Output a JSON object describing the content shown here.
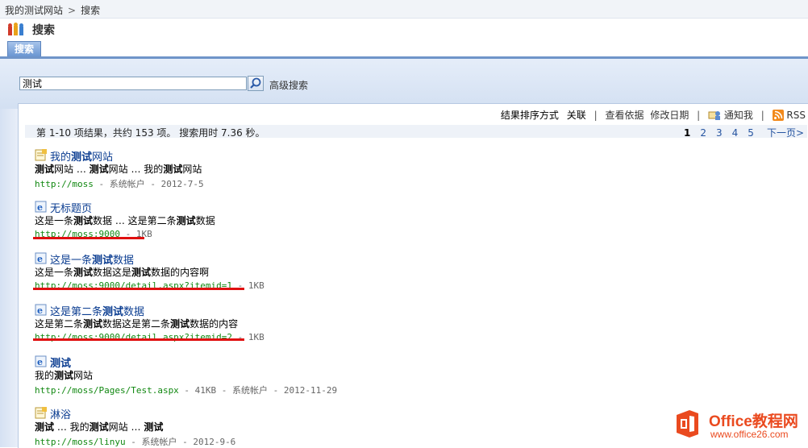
{
  "breadcrumb": {
    "site": "我的测试网站",
    "separator": ">",
    "current": "搜索"
  },
  "page": {
    "title": "搜索",
    "tab_label": "搜索"
  },
  "search": {
    "query": "测试",
    "advanced_label": "高级搜索"
  },
  "toolbar": {
    "sort_label": "结果排序方式",
    "sort_relevance": "关联",
    "view_by": "查看依据",
    "modified_date": "修改日期",
    "alert_me": "通知我",
    "rss": "RSS"
  },
  "summary": {
    "text": "第 1-10 项结果，共约 153 项。 搜索用时 7.36 秒。",
    "pages": [
      "1",
      "2",
      "3",
      "4",
      "5"
    ],
    "next": "下一页>"
  },
  "results": [
    {
      "icon": "note-doc-icon",
      "title_pre": "我的",
      "title_bold": "测试",
      "title_post": "网站",
      "snippet": [
        [
          "测试",
          true
        ],
        [
          "网站 … ",
          false
        ],
        [
          "测试",
          true
        ],
        [
          "网站 … 我的",
          false
        ],
        [
          "测试",
          true
        ],
        [
          "网站",
          false
        ]
      ],
      "url": "http://moss",
      "rest": " - 系统帐户 - 2012-7-5"
    },
    {
      "icon": "ie-page-icon",
      "title_pre": "无标题页",
      "title_bold": "",
      "title_post": "",
      "snippet": [
        [
          "这是一条",
          false
        ],
        [
          "测试",
          true
        ],
        [
          "数据 … 这是第二条",
          false
        ],
        [
          "测试",
          true
        ],
        [
          "数据",
          false
        ]
      ],
      "url": "http://moss:9000",
      "rest": " - 1KB"
    },
    {
      "icon": "ie-page-icon",
      "title_pre": "这是一条",
      "title_bold": "测试",
      "title_post": "数据",
      "snippet": [
        [
          "这是一条",
          false
        ],
        [
          "测试",
          true
        ],
        [
          "数据这是",
          false
        ],
        [
          "测试",
          true
        ],
        [
          "数据的内容啊",
          false
        ]
      ],
      "url": "http://moss:9000/detail.aspx?itemid=1",
      "rest": " - 1KB"
    },
    {
      "icon": "ie-page-icon",
      "title_pre": "这是第二条",
      "title_bold": "测试",
      "title_post": "数据",
      "snippet": [
        [
          "这是第二条",
          false
        ],
        [
          "测试",
          true
        ],
        [
          "数据这是第二条",
          false
        ],
        [
          "测试",
          true
        ],
        [
          "数据的内容",
          false
        ]
      ],
      "url": "http://moss:9000/detail.aspx?itemid=2",
      "rest": " - 1KB"
    },
    {
      "icon": "ie-page-icon",
      "title_pre": "",
      "title_bold": "测试",
      "title_post": "",
      "snippet": [
        [
          "我的",
          false
        ],
        [
          "测试",
          true
        ],
        [
          "网站",
          false
        ]
      ],
      "url": "http://moss/Pages/Test.aspx",
      "rest": " - 41KB - 系统帐户 - 2012-11-29"
    },
    {
      "icon": "note-doc-icon",
      "title_pre": "淋浴",
      "title_bold": "",
      "title_post": "",
      "snippet": [
        [
          "测试",
          true
        ],
        [
          " … 我的",
          false
        ],
        [
          "测试",
          true
        ],
        [
          "网站 … ",
          false
        ],
        [
          "测试",
          true
        ]
      ],
      "url": "http://moss/linyu",
      "rest": " - 系统帐户 - 2012-9-6"
    }
  ],
  "watermark": {
    "title": "Office教程网",
    "subtitle": "www.office26.com"
  },
  "colors": {
    "link": "#0b3d91",
    "url": "#118811",
    "accent": "#6f94c9",
    "underline": "#e01010",
    "watermark": "#ea4a1f"
  }
}
